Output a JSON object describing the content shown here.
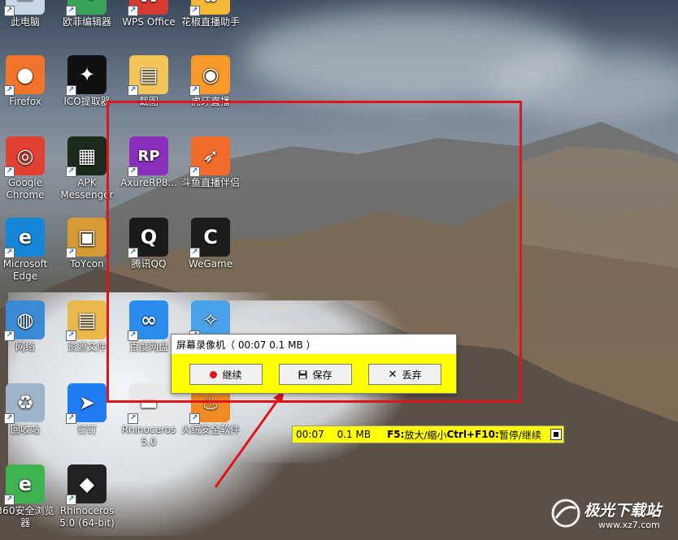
{
  "desktop_icons": [
    {
      "label": "此电脑",
      "icon": "computer-icon",
      "color": "#c9d6e6",
      "glyph": "▭"
    },
    {
      "label": "欧菲编辑器",
      "icon": "editor-icon",
      "color": "#3aa35a",
      "glyph": "✎"
    },
    {
      "label": "WPS Office",
      "icon": "wps-icon",
      "color": "#d73b2f",
      "glyph": "W"
    },
    {
      "label": "花椒直播助手",
      "icon": "huajiao-icon",
      "color": "#f4b836",
      "glyph": "✿"
    },
    {
      "label": "Firefox",
      "icon": "firefox-icon",
      "color": "#f2742a",
      "glyph": "●"
    },
    {
      "label": "ICO提取器",
      "icon": "ico-extractor-icon",
      "color": "#111111",
      "glyph": "✦"
    },
    {
      "label": "截图",
      "icon": "folder-icon",
      "color": "#f2c45a",
      "glyph": "▤"
    },
    {
      "label": "虎牙直播",
      "icon": "huya-icon",
      "color": "#f79a2b",
      "glyph": "◉"
    },
    {
      "label": "Google Chrome",
      "icon": "chrome-icon",
      "color": "#e14133",
      "glyph": "◎"
    },
    {
      "label": "APK Messenger",
      "icon": "android-icon",
      "color": "#1b2a1b",
      "glyph": "▦"
    },
    {
      "label": "AxureRP8...",
      "icon": "axure-icon",
      "color": "#8d2fbd",
      "glyph": "RP"
    },
    {
      "label": "斗鱼直播伴侣",
      "icon": "douyu-icon",
      "color": "#f26b2a",
      "glyph": "➶"
    },
    {
      "label": "Microsoft Edge",
      "icon": "edge-icon",
      "color": "#1686d9",
      "glyph": "e"
    },
    {
      "label": "ToYcon",
      "icon": "toycon-icon",
      "color": "#d69b34",
      "glyph": "▣"
    },
    {
      "label": "腾讯QQ",
      "icon": "qq-icon",
      "color": "#1b1b1b",
      "glyph": "Q"
    },
    {
      "label": "WeGame",
      "icon": "wegame-icon",
      "color": "#1c1c1c",
      "glyph": "C"
    },
    {
      "label": "网络",
      "icon": "network-icon",
      "color": "#3b8bd4",
      "glyph": "◍"
    },
    {
      "label": "资源文件",
      "icon": "folder-icon",
      "color": "#e9b94e",
      "glyph": "▤"
    },
    {
      "label": "百度网盘",
      "icon": "baidu-netdisk-icon",
      "color": "#2b8cf0",
      "glyph": "∞"
    },
    {
      "label": "",
      "icon": "safari-icon",
      "color": "#4aa2e8",
      "glyph": "✧"
    },
    {
      "label": "回收站",
      "icon": "recycle-bin-icon",
      "color": "#9fb4c9",
      "glyph": "♻"
    },
    {
      "label": "钉钉",
      "icon": "dingtalk-icon",
      "color": "#1f7cf2",
      "glyph": "➤"
    },
    {
      "label": "Rhinoceros 5.0",
      "icon": "rhino-icon",
      "color": "#e8e8e8",
      "glyph": "▬"
    },
    {
      "label": "火绒安全软件",
      "icon": "huorong-icon",
      "color": "#f08a24",
      "glyph": "♨"
    },
    {
      "label": "360安全浏览器",
      "icon": "360-browser-icon",
      "color": "#3fb34f",
      "glyph": "e"
    },
    {
      "label": "Rhinoceros 5.0 (64-bit)",
      "icon": "rhino64-icon",
      "color": "#222222",
      "glyph": "◆"
    }
  ],
  "recorder": {
    "title": "屏幕录像机（ 00:07    0.1 MB ）",
    "close": "✕",
    "continue_label": "继续",
    "save_label": "保存",
    "discard_label": "丢弃"
  },
  "status": {
    "time": "00:07",
    "size": "0.1 MB",
    "hint_f5_key": "F5:",
    "hint_f5_text": " 放大/缩小 ",
    "hint_f10_key": "Ctrl+F10:",
    "hint_f10_text": " 暂停/继续"
  },
  "watermark": {
    "text": "极光下载站",
    "url": "www.xz7.com"
  },
  "colors": {
    "highlight": "#e0141b",
    "recorder_bg": "#ffff00"
  }
}
